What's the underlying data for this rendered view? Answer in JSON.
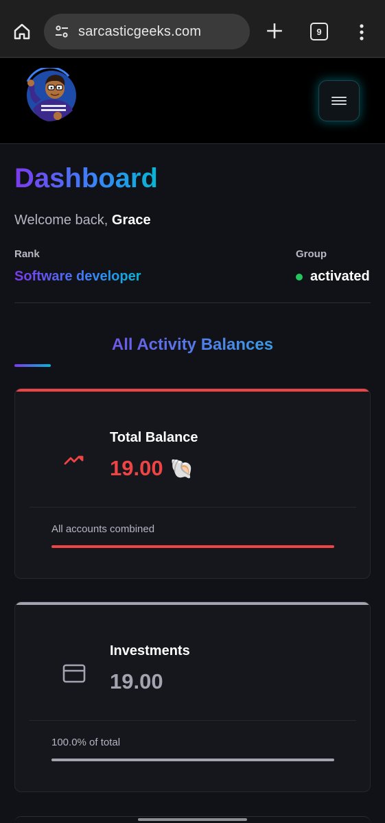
{
  "browser": {
    "url": "sarcasticgeeks.com",
    "tab_count": "9"
  },
  "header": {
    "avatar_icon": "cartoon-avatar",
    "menu_icon": "hamburger-icon"
  },
  "page": {
    "title": "Dashboard",
    "welcome_prefix": "Welcome back, ",
    "user_name": "Grace",
    "rank_label": "Rank",
    "rank_value": "Software developer",
    "group_label": "Group",
    "group_value": "activated",
    "group_status_color": "#22c55e"
  },
  "section": {
    "title": "All Activity Balances"
  },
  "cards": [
    {
      "title": "Total Balance",
      "amount": "19.00",
      "currency_icon": "🐚",
      "note": "All accounts combined",
      "progress": 1.0,
      "accent": "#ef4444",
      "icon": "trending-icon"
    },
    {
      "title": "Investments",
      "amount": "19.00",
      "note": "100.0% of total",
      "progress": 1.0,
      "accent": "#a3a4b0",
      "icon": "card-icon"
    }
  ]
}
